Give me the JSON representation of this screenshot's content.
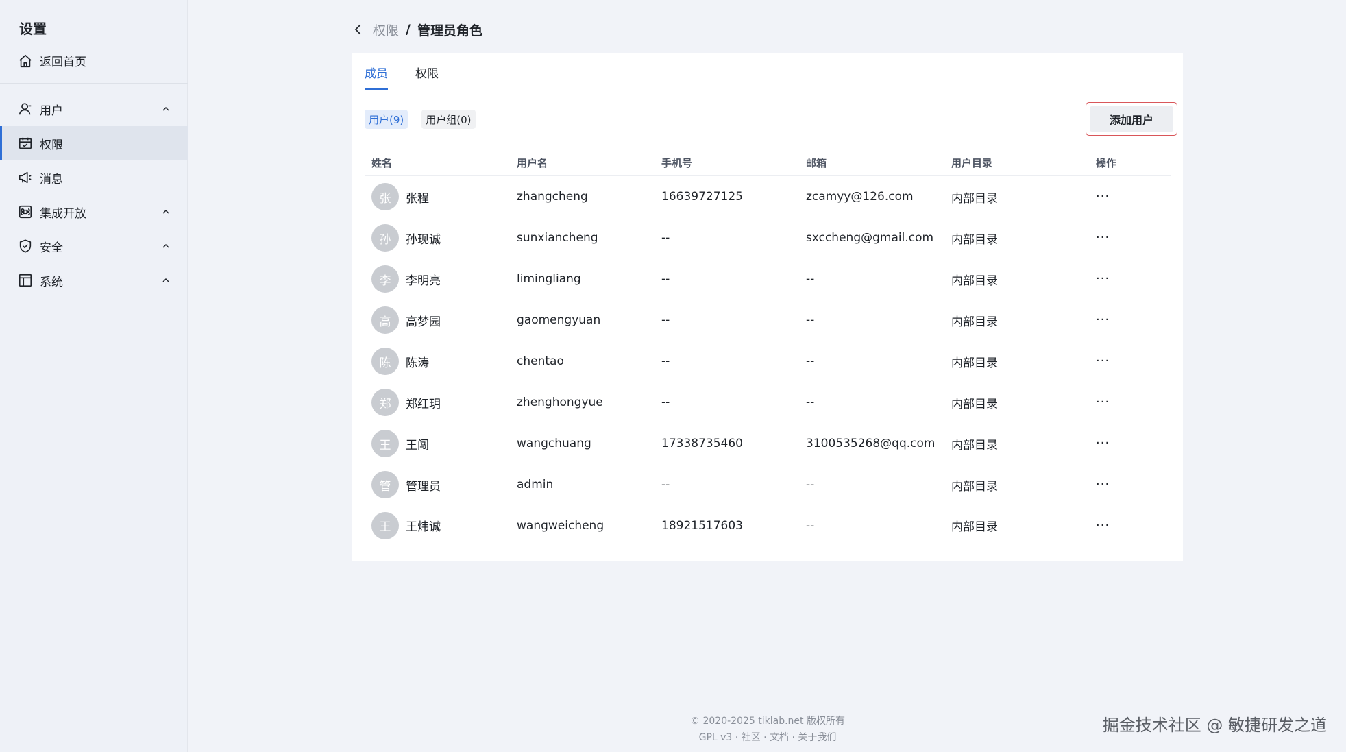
{
  "sidebar": {
    "title": "设置",
    "home_label": "返回首页",
    "items": [
      {
        "label": "用户",
        "icon": "user-icon",
        "expandable": true
      },
      {
        "label": "权限",
        "icon": "calendar-check-icon",
        "expandable": false,
        "active": true
      },
      {
        "label": "消息",
        "icon": "megaphone-icon",
        "expandable": false
      },
      {
        "label": "集成开放",
        "icon": "command-icon",
        "expandable": true
      },
      {
        "label": "安全",
        "icon": "shield-icon",
        "expandable": true
      },
      {
        "label": "系统",
        "icon": "layout-icon",
        "expandable": true
      }
    ]
  },
  "breadcrumb": {
    "parent": "权限",
    "separator": "/",
    "current": "管理员角色"
  },
  "tabs": [
    {
      "label": "成员",
      "active": true
    },
    {
      "label": "权限",
      "active": false
    }
  ],
  "filters": [
    {
      "label": "用户(9)",
      "active": true
    },
    {
      "label": "用户组(0)",
      "active": false
    }
  ],
  "add_user_label": "添加用户",
  "table": {
    "headers": [
      "姓名",
      "用户名",
      "手机号",
      "邮箱",
      "用户目录",
      "操作"
    ],
    "rows": [
      {
        "avatar": "张",
        "name": "张程",
        "username": "zhangcheng",
        "phone": "16639727125",
        "email": "zcamyy@126.com",
        "directory": "内部目录",
        "action": "···"
      },
      {
        "avatar": "孙",
        "name": "孙现诚",
        "username": "sunxiancheng",
        "phone": "--",
        "email": "sxccheng@gmail.com",
        "directory": "内部目录",
        "action": "···"
      },
      {
        "avatar": "李",
        "name": "李明亮",
        "username": "limingliang",
        "phone": "--",
        "email": "--",
        "directory": "内部目录",
        "action": "···"
      },
      {
        "avatar": "高",
        "name": "高梦园",
        "username": "gaomengyuan",
        "phone": "--",
        "email": "--",
        "directory": "内部目录",
        "action": "···"
      },
      {
        "avatar": "陈",
        "name": "陈涛",
        "username": "chentao",
        "phone": "--",
        "email": "--",
        "directory": "内部目录",
        "action": "···"
      },
      {
        "avatar": "郑",
        "name": "郑红玥",
        "username": "zhenghongyue",
        "phone": "--",
        "email": "--",
        "directory": "内部目录",
        "action": "···"
      },
      {
        "avatar": "王",
        "name": "王闯",
        "username": "wangchuang",
        "phone": "17338735460",
        "email": "3100535268@qq.com",
        "directory": "内部目录",
        "action": "···"
      },
      {
        "avatar": "管",
        "name": "管理员",
        "username": "admin",
        "phone": "--",
        "email": "--",
        "directory": "内部目录",
        "action": "···"
      },
      {
        "avatar": "王",
        "name": "王炜诚",
        "username": "wangweicheng",
        "phone": "18921517603",
        "email": "--",
        "directory": "内部目录",
        "action": "···"
      }
    ]
  },
  "footer": {
    "copyright": "© 2020-2025 tiklab.net 版权所有",
    "license": "GPL v3",
    "sep": "·",
    "community": "社区",
    "docs": "文档",
    "about": "关于我们"
  },
  "watermark": "掘金技术社区 @ 敏捷研发之道",
  "colors": {
    "accent": "#2f6fd6",
    "sidebar_bg": "#eef1f7",
    "page_bg": "#f1f3f8",
    "avatar_bg": "#c9ccd1",
    "button_border": "#d9565a"
  }
}
